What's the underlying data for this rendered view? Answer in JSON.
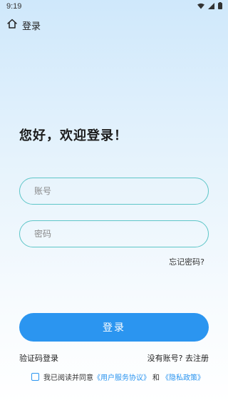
{
  "status_bar": {
    "time": "9:19",
    "icons": [
      "wifi-icon",
      "signal-icon",
      "battery-icon"
    ]
  },
  "header": {
    "title": "登录",
    "icon": "home-icon"
  },
  "greeting": "您好，欢迎登录！",
  "form": {
    "account_placeholder": "账号",
    "password_placeholder": "密码",
    "forgot_password": "忘记密码?",
    "login_button": "登录"
  },
  "alt_actions": {
    "sms_login": "验证码登录",
    "no_account": "没有账号?",
    "register": "去注册"
  },
  "agreement": {
    "checked": false,
    "prefix": "我已阅读并同意",
    "user_agreement": "《用户服务协议》",
    "conjunction": "和",
    "privacy_policy": "《隐私政策》"
  },
  "colors": {
    "accent": "#2b95f0",
    "field_border": "#5ec6c8",
    "background_top": "#cfe8fb"
  }
}
